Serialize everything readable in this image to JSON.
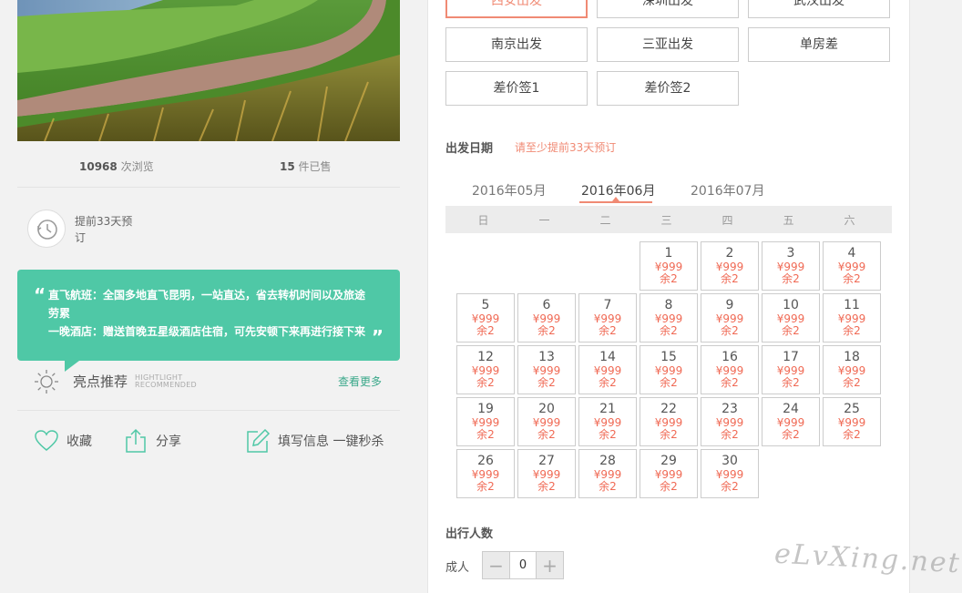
{
  "stats": {
    "views_count": "10968",
    "views_label": "次浏览",
    "sold_count": "15",
    "sold_label": "件已售"
  },
  "advance_booking": "提前33天预订",
  "tip": {
    "line1": "直飞航班：全国多地直飞昆明，一站直达，省去转机时间以及旅途劳累",
    "line2": "一晚酒店：赠送首晚五星级酒店住宿，可先安顿下来再进行接下来"
  },
  "recommend": {
    "title": "亮点推荐",
    "en1": "HIGHTLIGHT",
    "en2": "RECOMMENDED",
    "more": "查看更多"
  },
  "actions": {
    "favorite": "收藏",
    "share": "分享",
    "fill_info": "填写信息 一键秒杀"
  },
  "departure_options": [
    {
      "label": "西安出发",
      "selected": true
    },
    {
      "label": "深圳出发",
      "selected": false
    },
    {
      "label": "武汉出发",
      "selected": false
    },
    {
      "label": "南京出发",
      "selected": false
    },
    {
      "label": "三亚出发",
      "selected": false
    },
    {
      "label": "单房差",
      "selected": false
    },
    {
      "label": "差价签1",
      "selected": false
    },
    {
      "label": "差价签2",
      "selected": false
    }
  ],
  "departure_date": {
    "title": "出发日期",
    "note": "请至少提前33天预订",
    "months": [
      "2016年05月",
      "2016年06月",
      "2016年07月"
    ],
    "active_month": "2016年06月",
    "weekdays": [
      "日",
      "一",
      "二",
      "三",
      "四",
      "五",
      "六"
    ],
    "first_weekday_index": 3,
    "days": 30,
    "price": "¥999",
    "remaining": "余2"
  },
  "travelers": {
    "title": "出行人数",
    "adult_label": "成人",
    "adult_count": "0",
    "minus": "−",
    "plus": "+"
  },
  "watermark": "eLvXing.net",
  "colors": {
    "accent": "#f08a74",
    "price": "#f06a55",
    "green": "#4fc8a6",
    "link_green": "#3aa88a"
  }
}
